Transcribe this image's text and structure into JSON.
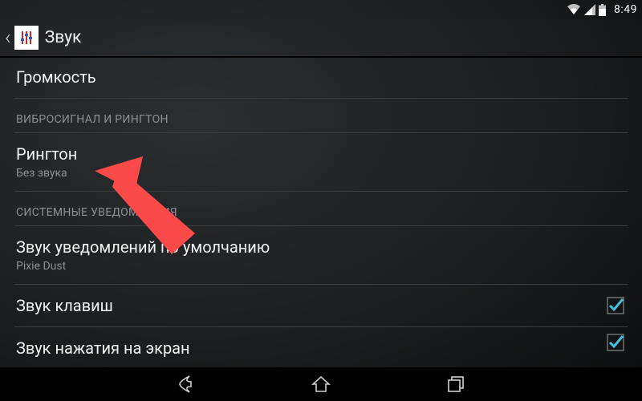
{
  "status": {
    "time": "8:49"
  },
  "actionbar": {
    "title": "Звук"
  },
  "rows": {
    "volume": {
      "label": "Громкость"
    },
    "section_vibro": "ВИБРОСИГНАЛ И РИНГТОН",
    "ringtone": {
      "label": "Рингтон",
      "value": "Без звука"
    },
    "section_system": "СИСТЕМНЫЕ УВЕДОМЛЕНИЯ",
    "default_notification": {
      "label": "Звук уведомлений по умолчанию",
      "value": "Pixie Dust"
    },
    "dial_pad": {
      "label": "Звук клавиш",
      "checked": true
    },
    "touch_sounds": {
      "label": "Звук нажатия на экран",
      "checked": true
    }
  },
  "colors": {
    "accent": "#3ec0e0",
    "callout": "#fc4a4a"
  }
}
